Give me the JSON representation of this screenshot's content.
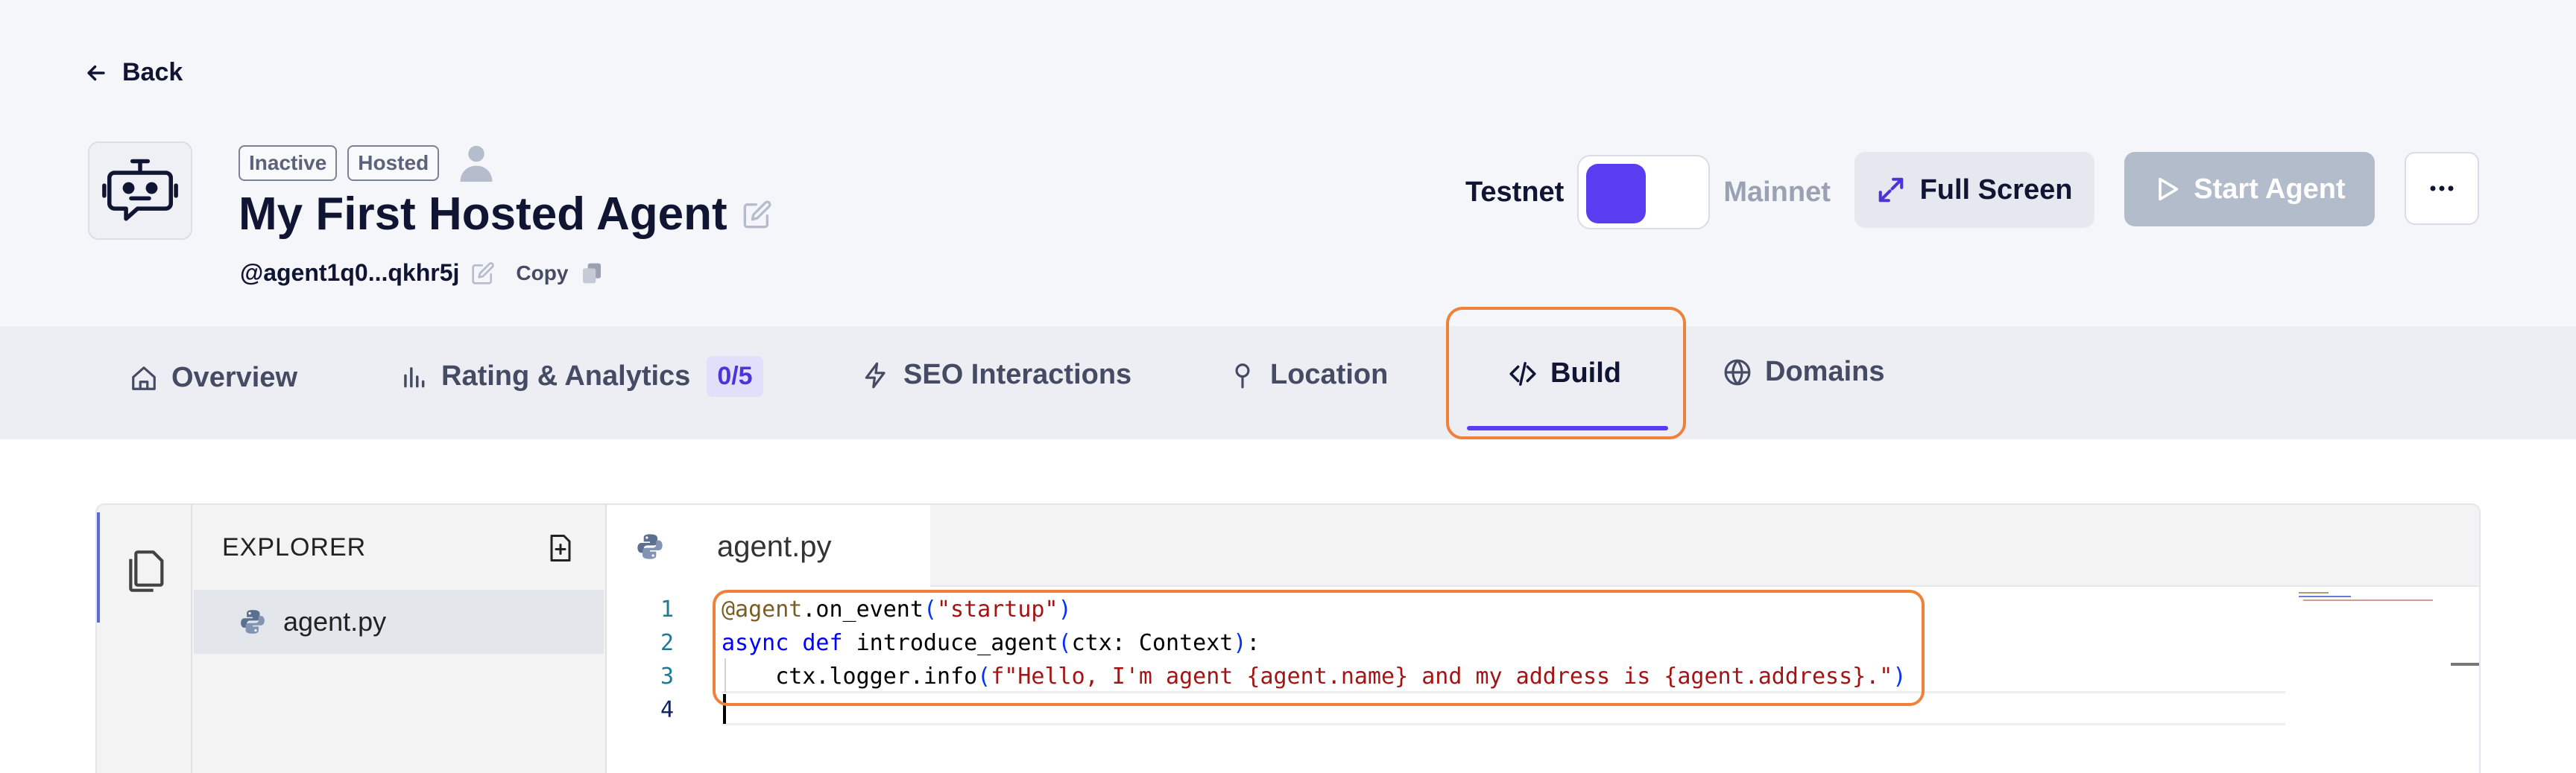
{
  "header": {
    "back_label": "Back",
    "badges": [
      "Inactive",
      "Hosted"
    ],
    "agent_name": "My First Hosted Agent",
    "agent_address": "@agent1q0...qkhr5j",
    "copy_label": "Copy"
  },
  "network": {
    "testnet_label": "Testnet",
    "mainnet_label": "Mainnet",
    "selected": "Testnet"
  },
  "actions": {
    "full_screen_label": "Full Screen",
    "start_agent_label": "Start Agent"
  },
  "tabs": [
    {
      "label": "Overview",
      "icon": "home-icon"
    },
    {
      "label": "Rating & Analytics",
      "icon": "bar-chart-icon",
      "count": "0/5"
    },
    {
      "label": "SEO Interactions",
      "icon": "lightning-icon"
    },
    {
      "label": "Location",
      "icon": "pin-icon"
    },
    {
      "label": "Build",
      "icon": "code-icon",
      "active": true
    },
    {
      "label": "Domains",
      "icon": "globe-icon"
    }
  ],
  "explorer": {
    "title": "EXPLORER",
    "files": [
      "agent.py"
    ]
  },
  "editor": {
    "open_tab": "agent.py",
    "lines": [
      {
        "n": "1",
        "parts": [
          [
            "dec",
            "@agent"
          ],
          [
            "txt",
            ".on_event"
          ],
          [
            "paren",
            "("
          ],
          [
            "str",
            "\"startup\""
          ],
          [
            "paren",
            ")"
          ]
        ]
      },
      {
        "n": "2",
        "parts": [
          [
            "kw",
            "async"
          ],
          [
            "txt",
            " "
          ],
          [
            "kw",
            "def"
          ],
          [
            "txt",
            " introduce_agent"
          ],
          [
            "paren",
            "("
          ],
          [
            "txt",
            "ctx: Context"
          ],
          [
            "paren",
            ")"
          ],
          [
            "txt",
            ":"
          ]
        ]
      },
      {
        "n": "3",
        "parts": [
          [
            "txt",
            "    ctx.logger.info"
          ],
          [
            "paren",
            "("
          ],
          [
            "str",
            "f\"Hello, I'm agent {agent.name} and my address is {agent.address}.\""
          ],
          [
            "paren",
            ")"
          ]
        ]
      },
      {
        "n": "4",
        "parts": []
      }
    ]
  },
  "colors": {
    "accent": "#5a3df0",
    "highlight_outline": "#f0813a",
    "start_button": "#b3bccb"
  }
}
